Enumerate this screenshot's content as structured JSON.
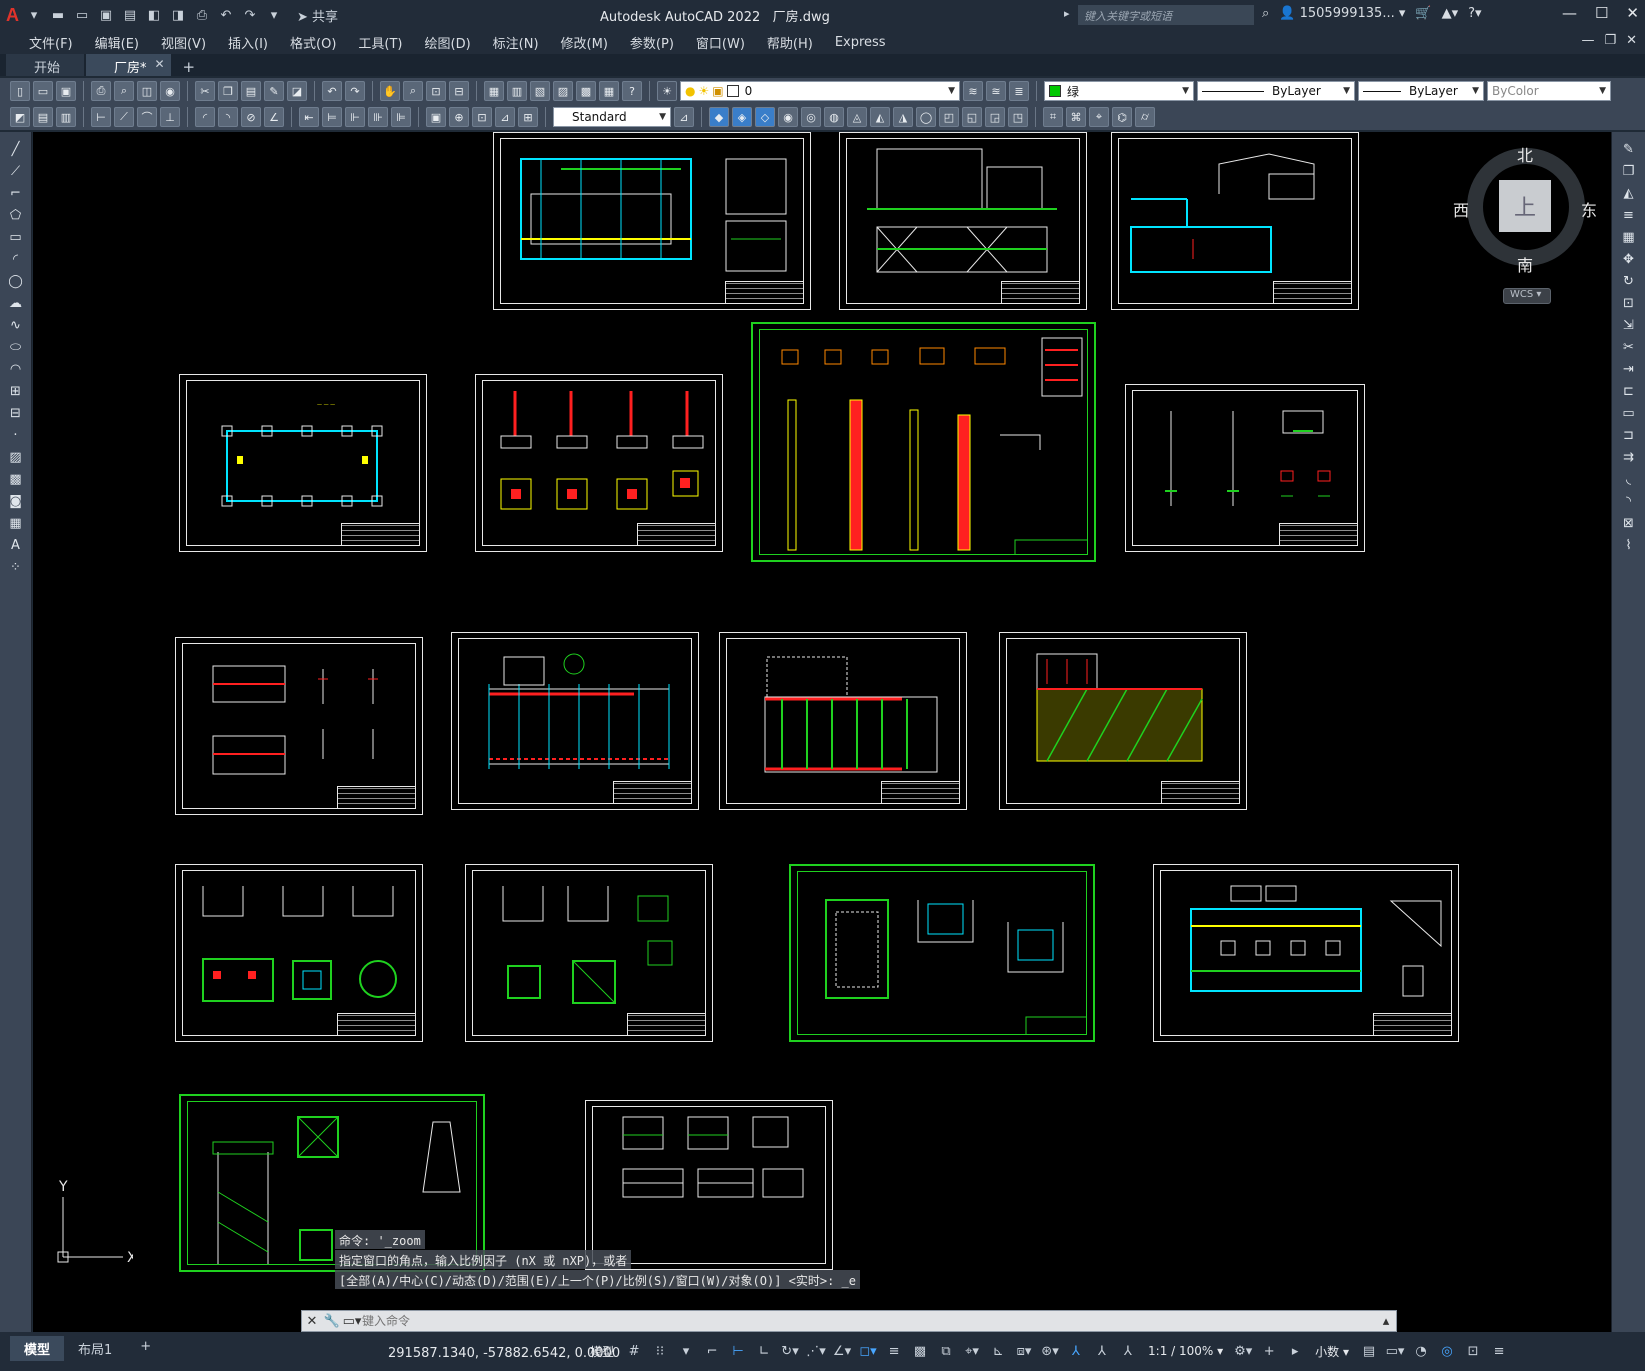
{
  "app": {
    "logo": "A",
    "title": "Autodesk AutoCAD 2022",
    "filename": "厂房.dwg",
    "share_label": "共享",
    "search_placeholder": "键入关键字或短语",
    "user": "1505999135...",
    "help_icon": "question-icon"
  },
  "menu": [
    "文件(F)",
    "编辑(E)",
    "视图(V)",
    "插入(I)",
    "格式(O)",
    "工具(T)",
    "绘图(D)",
    "标注(N)",
    "修改(M)",
    "参数(P)",
    "窗口(W)",
    "帮助(H)",
    "Express"
  ],
  "tabs": [
    {
      "label": "开始",
      "active": false
    },
    {
      "label": "厂房*",
      "active": true
    }
  ],
  "toolbar": {
    "layer_value": "0",
    "color_value": "绿",
    "color_hex": "#00c800",
    "linetype_value": "ByLayer",
    "lineweight_value": "ByLayer",
    "plotstyle_value": "ByColor",
    "textstyle_value": "Standard"
  },
  "viewcube": {
    "face": "上",
    "north": "北",
    "south": "南",
    "east": "东",
    "west": "西",
    "wcs": "WCS"
  },
  "ucs": {
    "y": "Y",
    "x": "X"
  },
  "command": {
    "history": [
      "命令: '_zoom",
      "指定窗口的角点，输入比例因子 (nX 或 nXP)，或者",
      "[全部(A)/中心(C)/动态(D)/范围(E)/上一个(P)/比例(S)/窗口(W)/对象(O)] <实时>: _e"
    ],
    "placeholder": "键入命令"
  },
  "status": {
    "layouts": [
      "模型",
      "布局1"
    ],
    "coordinates": "291587.1340, -57882.6542, 0.0000",
    "model_label": "模型",
    "scale": "1:1 / 100%",
    "units": "小数"
  },
  "colors": {
    "accent_green": "#1fd11f",
    "cyan": "#00e5ff",
    "red": "#ff2020",
    "yellow": "#ffff00",
    "background": "#000000"
  }
}
